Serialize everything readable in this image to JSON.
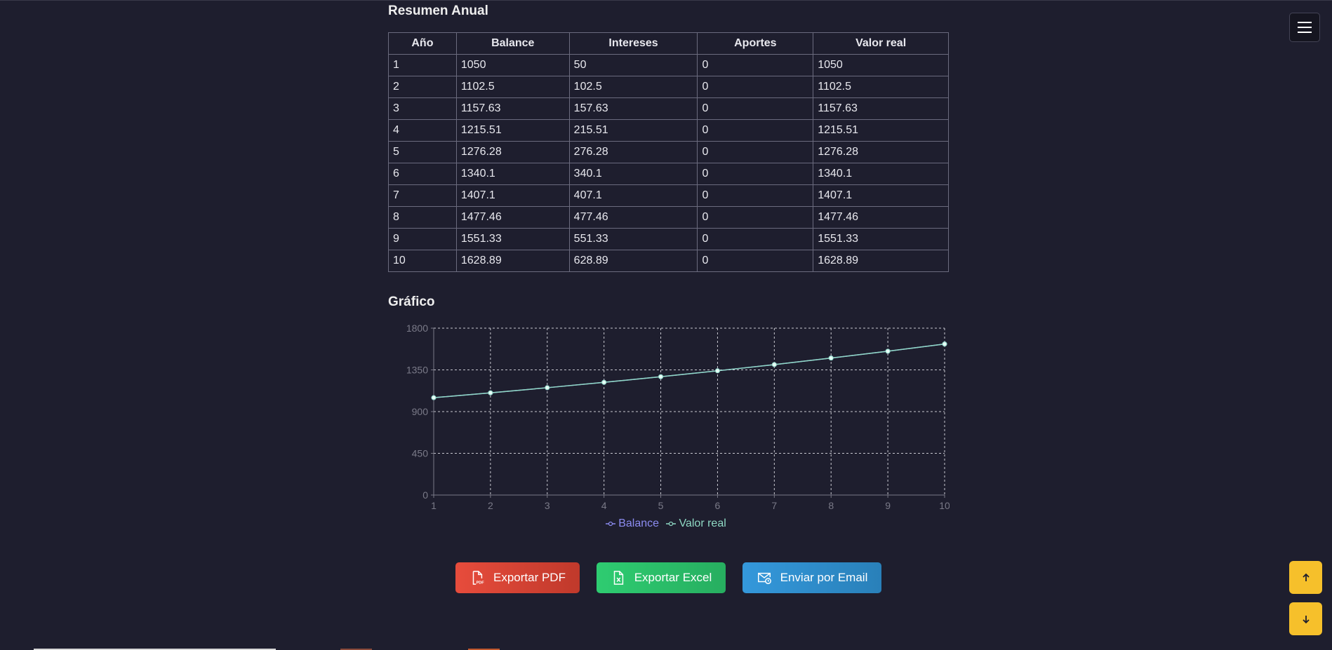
{
  "summary": {
    "title": "Resumen Anual",
    "headers": [
      "Año",
      "Balance",
      "Intereses",
      "Aportes",
      "Valor real"
    ],
    "rows": [
      [
        "1",
        "1050",
        "50",
        "0",
        "1050"
      ],
      [
        "2",
        "1102.5",
        "102.5",
        "0",
        "1102.5"
      ],
      [
        "3",
        "1157.63",
        "157.63",
        "0",
        "1157.63"
      ],
      [
        "4",
        "1215.51",
        "215.51",
        "0",
        "1215.51"
      ],
      [
        "5",
        "1276.28",
        "276.28",
        "0",
        "1276.28"
      ],
      [
        "6",
        "1340.1",
        "340.1",
        "0",
        "1340.1"
      ],
      [
        "7",
        "1407.1",
        "407.1",
        "0",
        "1407.1"
      ],
      [
        "8",
        "1477.46",
        "477.46",
        "0",
        "1477.46"
      ],
      [
        "9",
        "1551.33",
        "551.33",
        "0",
        "1551.33"
      ],
      [
        "10",
        "1628.89",
        "628.89",
        "0",
        "1628.89"
      ]
    ]
  },
  "chart_section": {
    "title": "Gráfico"
  },
  "chart_data": {
    "type": "line",
    "x": [
      1,
      2,
      3,
      4,
      5,
      6,
      7,
      8,
      9,
      10
    ],
    "xticks": [
      "1",
      "2",
      "3",
      "4",
      "5",
      "6",
      "7",
      "8",
      "9",
      "10"
    ],
    "yticks": [
      0,
      450,
      900,
      1350,
      1800
    ],
    "ylim": [
      0,
      1800
    ],
    "xlim": [
      1,
      10
    ],
    "grid": true,
    "legend_position": "bottom",
    "series": [
      {
        "name": "Balance",
        "color": "#8c8cf0",
        "values": [
          1050,
          1102.5,
          1157.63,
          1215.51,
          1276.28,
          1340.1,
          1407.1,
          1477.46,
          1551.33,
          1628.89
        ]
      },
      {
        "name": "Valor real",
        "color": "#8fd9c4",
        "values": [
          1050,
          1102.5,
          1157.63,
          1215.51,
          1276.28,
          1340.1,
          1407.1,
          1477.46,
          1551.33,
          1628.89
        ]
      }
    ]
  },
  "actions": {
    "export_pdf": "Exportar PDF",
    "export_excel": "Exportar Excel",
    "send_email": "Enviar por Email",
    "pdf_icon_text": "PDF"
  },
  "colors": {
    "background": "#1e1e2e",
    "pdf_button": "#e74c3c",
    "excel_button": "#2ecc71",
    "email_button": "#3498db",
    "scroll_button": "#f6c02b"
  },
  "icons": {
    "menu": "hamburger-menu-icon",
    "pdf": "file-pdf-icon",
    "excel": "file-excel-icon",
    "email": "mail-clock-icon",
    "scroll_up": "arrow-up-icon",
    "scroll_down": "arrow-down-icon"
  }
}
